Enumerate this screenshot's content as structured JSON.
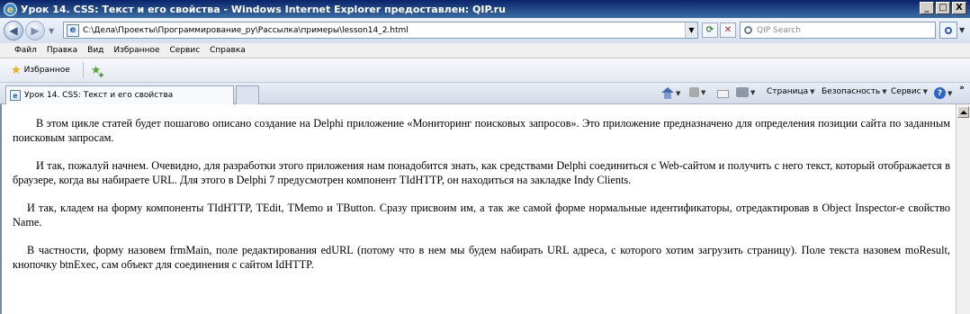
{
  "window": {
    "title": "Урок 14. CSS: Текст и его свойства - Windows Internet Explorer предоставлен: QIP.ru",
    "controls": [
      "_",
      "□",
      "X"
    ]
  },
  "address": {
    "url": "C:\\Дела\\Проекты\\Программирование_ру\\Рассылка\\примеры\\lesson14_2.html",
    "search_placeholder": "QIP Search"
  },
  "menu": {
    "items": [
      "Файл",
      "Правка",
      "Вид",
      "Избранное",
      "Сервис",
      "Справка"
    ]
  },
  "favorites": {
    "label": "Избранное"
  },
  "tab": {
    "title": "Урок 14. CSS: Текст и его свойства"
  },
  "commands": {
    "page": "Страница",
    "safety": "Безопасность",
    "service": "Сервис",
    "more": "»"
  },
  "article": {
    "paragraphs": [
      "В этом цикле статей будет пошагово описано создание на Delphi приложение «Мониторинг поисковых запросов». Это приложение предназначено для определения позиции сайта по заданным поисковым запросам.",
      "И так, пожалуй начнем. Очевидно, для разработки этого приложения нам понадобится знать, как средствами Delphi соединиться с Web-сайтом и получить с него текст, который отображается в браузере, когда вы набираете URL. Для этого в Delphi 7 предусмотрен компонент TIdHTTP, он находиться на закладке Indy Clients.",
      "И так, кладем на форму компоненты TIdHTTP, TEdit, TMemo и TButton. Сразу присвоим им, а так же самой форме нормальные идентификаторы, отредактировав в Object Inspector-е свойство Name.",
      "В частности, форму назовем frmMain, поле редактирования edURL (потому что в нем мы будем набирать URL адреса, с которого хотим загрузить страницу). Поле текста назовем moResult, кнопочку btnExec, сам объект для соединения с сайтом IdHTTP."
    ]
  }
}
